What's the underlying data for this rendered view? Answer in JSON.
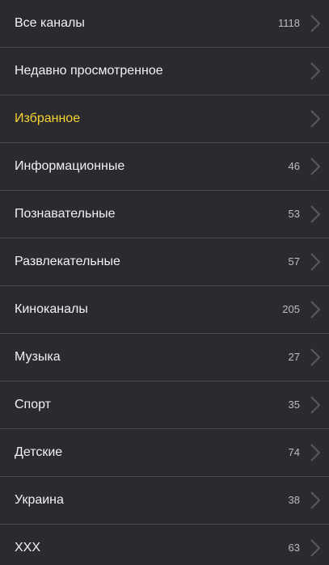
{
  "categories": [
    {
      "label": "Все каналы",
      "count": "1118"
    },
    {
      "label": "Недавно просмотренное",
      "count": ""
    },
    {
      "label": "Избранное",
      "count": ""
    },
    {
      "label": "Информационные",
      "count": "46"
    },
    {
      "label": "Познавательные",
      "count": "53"
    },
    {
      "label": "Развлекательные",
      "count": "57"
    },
    {
      "label": "Киноканалы",
      "count": "205"
    },
    {
      "label": "Музыка",
      "count": "27"
    },
    {
      "label": "Спорт",
      "count": "35"
    },
    {
      "label": "Детские",
      "count": "74"
    },
    {
      "label": "Украина",
      "count": "38"
    },
    {
      "label": "XXX",
      "count": "63"
    }
  ],
  "colors": {
    "background": "#2b2a2f",
    "divider": "#4a494f",
    "text": "#f2f2f2",
    "favorite_text": "#f6d42f",
    "count_text": "#bdbdbf",
    "chevron": "#5a595f"
  },
  "icons": {
    "row_arrow": "chevron-right-icon"
  }
}
